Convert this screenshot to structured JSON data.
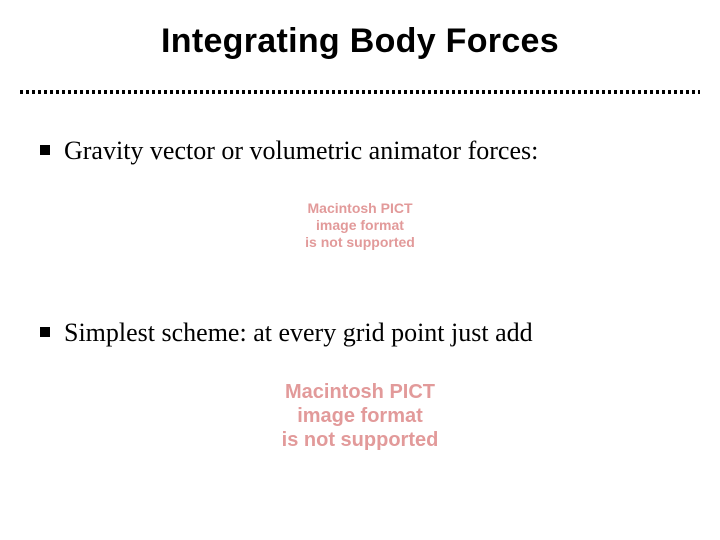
{
  "slide": {
    "title": "Integrating Body Forces",
    "bullets": [
      "Gravity vector or volumetric animator forces:",
      "Simplest scheme: at every grid point just add"
    ],
    "placeholders": {
      "pict": {
        "line1": "Macintosh PICT",
        "line2": "image format",
        "line3": "is not supported"
      }
    },
    "colors": {
      "placeholder_text": "#e29a9a",
      "text": "#000000"
    }
  }
}
